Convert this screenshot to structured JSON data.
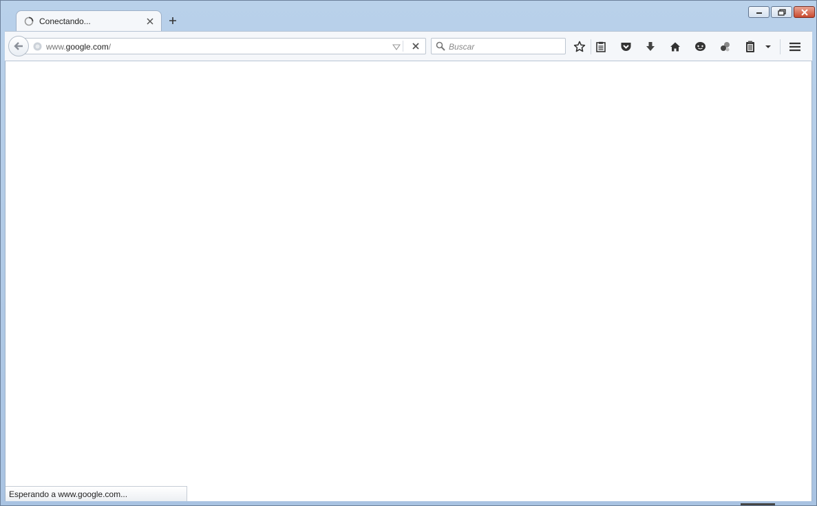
{
  "window": {
    "caption_buttons": [
      {
        "name": "minimize",
        "icon": "minimize-icon"
      },
      {
        "name": "restore",
        "icon": "restore-icon"
      },
      {
        "name": "close",
        "icon": "close-icon",
        "color": "#c94a2f"
      }
    ]
  },
  "tabs": [
    {
      "title": "Conectando...",
      "icon": "loading-throbber-icon",
      "close_icon": "close-tab-icon"
    }
  ],
  "new_tab_icon": "plus-icon",
  "navbar": {
    "back_icon": "back-arrow-icon",
    "url_host": "www.google.com/",
    "url_prefix": "www.",
    "url_domain": "google.com",
    "url_suffix": "/",
    "search_placeholder": "Buscar",
    "toolbar_icons": [
      "bookmark-star-icon",
      "reader-list-icon",
      "pocket-icon",
      "download-arrow-icon",
      "home-icon",
      "chat-bubble-icon",
      "extension-icon",
      "clipboard-icon",
      "overflow-dropdown-icon",
      "hamburger-menu-icon"
    ]
  },
  "status": {
    "text": "Esperando a www.google.com..."
  }
}
